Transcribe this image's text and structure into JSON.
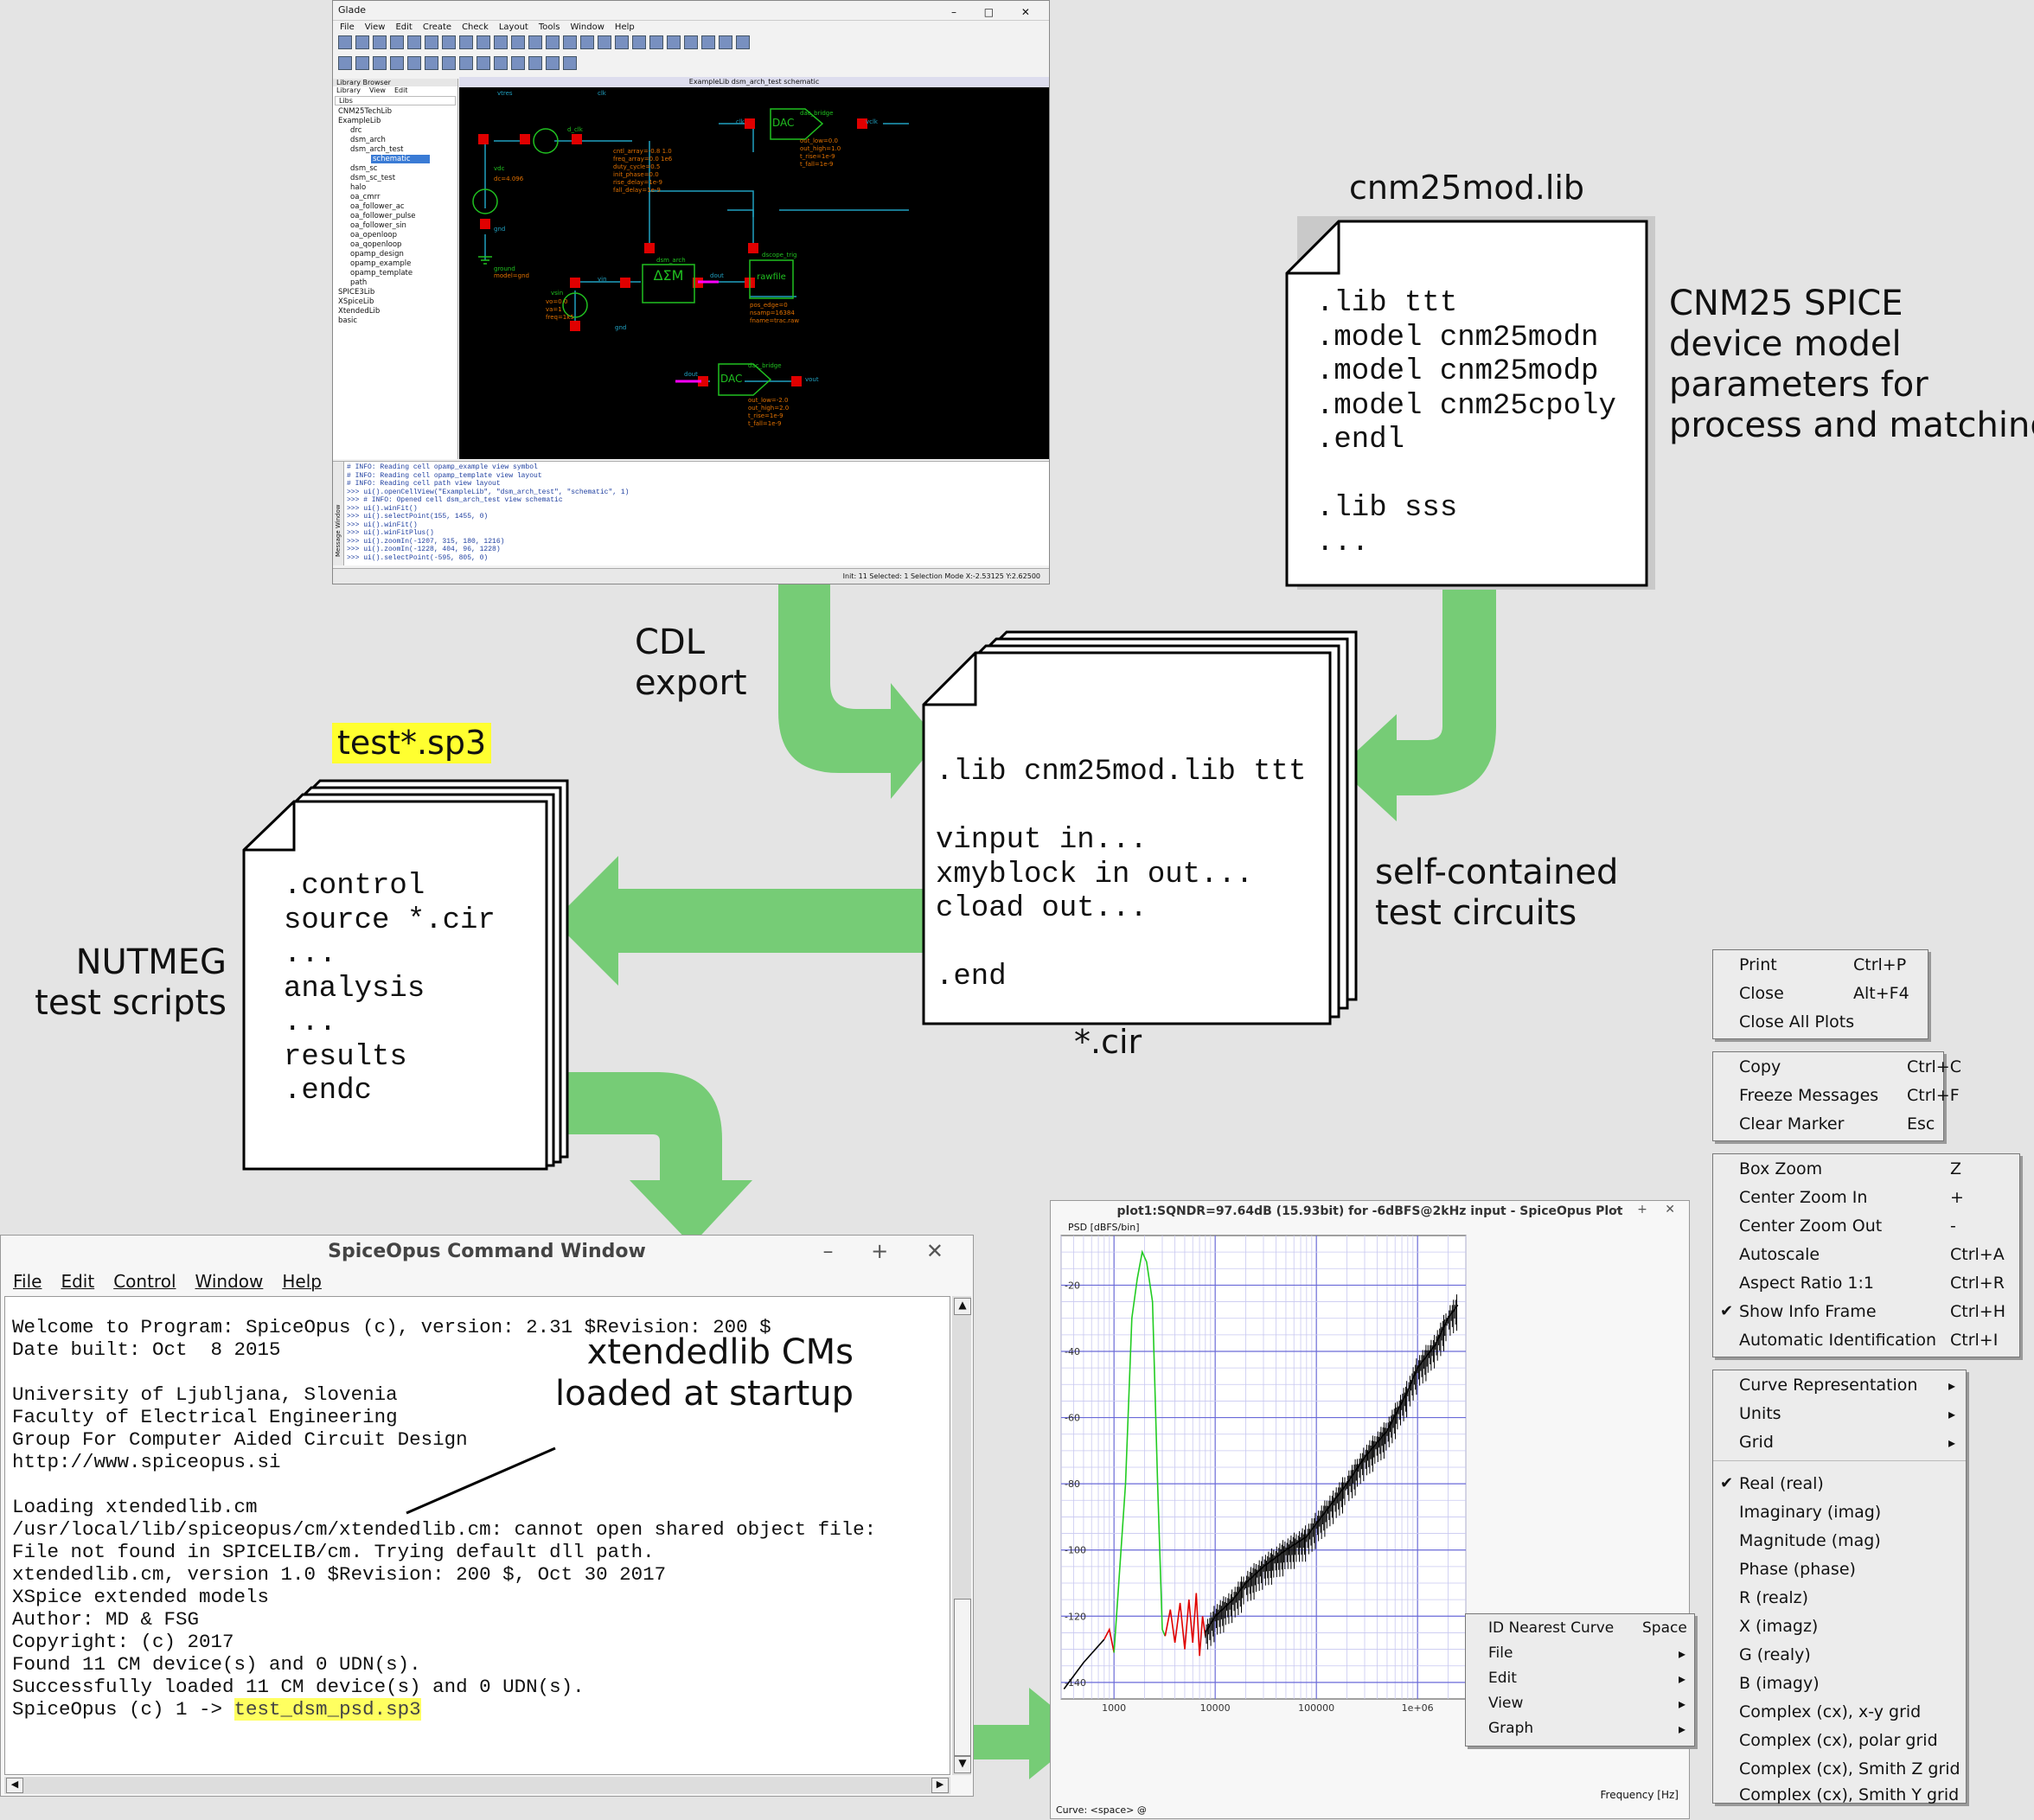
{
  "glade": {
    "title": "Glade",
    "window_controls": "–  □  ✕",
    "menu": [
      "File",
      "View",
      "Edit",
      "Create",
      "Check",
      "Layout",
      "Tools",
      "Window",
      "Help"
    ],
    "library_browser": "Library Browser",
    "lib_menu": [
      "Library",
      "View",
      "Edit"
    ],
    "libs_header": "Libs",
    "libs": [
      "CNM25TechLib",
      "ExampleLib",
      "drc",
      "dsm_arch",
      "dsm_arch_test",
      "schematic",
      "dsm_sc",
      "dsm_sc_test",
      "halo",
      "oa_cmrr",
      "oa_follower_ac",
      "oa_follower_pulse",
      "oa_follower_sin",
      "oa_openloop",
      "oa_qopenloop",
      "opamp_design",
      "opamp_example",
      "opamp_template",
      "path",
      "SPICE3Lib",
      "XSpiceLib",
      "XtendedLib",
      "basic"
    ],
    "schematic_title": "ExampleLib dsm_arch_test schematic",
    "schem_labels": {
      "vtres": "vtres",
      "clk": "clk",
      "dclk": "d_clk",
      "vdc": "vdc",
      "dc": "dc=4.096",
      "gnd": "gnd",
      "ground": "ground",
      "model": "model=gnd",
      "vin": "vin",
      "vsin": "vsin",
      "dsm_arch": "dsm_arch",
      "dout": "dout",
      "dscope": "dscope_trig",
      "dac_bridge": "dac_bridge",
      "vclk": "vclk",
      "vout": "vout",
      "dac": "DAC",
      "sigma": "ΔΣM",
      "rawfile": "rawfile"
    },
    "clk_params": [
      "cntl_array=-0.8 1.0",
      "freq_array=0.0 1e6",
      "duty_cycle=0.5",
      "init_phase=0.0",
      "rise_delay=1e-9",
      "fall_delay=1e-9"
    ],
    "dac_params": [
      "out_low=0.0",
      "out_high=1.0",
      "t_rise=1e-9",
      "t_fall=1e-9"
    ],
    "dac2_params": [
      "out_low=-2.0",
      "out_high=2.0",
      "t_rise=1e-9",
      "t_fall=1e-9"
    ],
    "vsin_params": [
      "vo=0.0",
      "va=1",
      "freq=1k5"
    ],
    "scope_params": [
      "pos_edge=0",
      "nsamp=16384",
      "fname=trac.raw"
    ],
    "messages": [
      "# INFO: Reading cell opamp_example view symbol",
      "# INFO: Reading cell opamp_template view layout",
      "# INFO: Reading cell path view layout",
      ">>> ui().openCellView(\"ExampleLib\", \"dsm_arch_test\", \"schematic\", 1)",
      ">>> # INFO: Opened cell dsm_arch_test view schematic",
      ">>> ui().winFit()",
      ">>> ui().selectPoint(155, 1455, 0)",
      ">>> ui().winFit()",
      ">>> ui().winFitPlus()",
      ">>> ui().zoomIn(-1207, 315, 180, 1216)",
      ">>> ui().zoomIn(-1228, 404, 96, 1228)",
      ">>> ui().selectPoint(-595, 805, 0)"
    ],
    "message_window": "Message Window",
    "status": "Init: 11   Selected: 1   Selection Mode   X:-2.53125 Y:2.62500"
  },
  "cnm_lib": {
    "title": "cnm25mod.lib",
    "text": ".lib ttt\n.model cnm25modn\n.model cnm25modp\n.model cnm25cpoly\n.endl\n\n.lib sss\n..."
  },
  "cnm_desc": [
    "CNM25 SPICE",
    "device model",
    "parameters for",
    "process and matching"
  ],
  "cdl_export": [
    "CDL",
    "export"
  ],
  "cir_doc": {
    "text": ".lib cnm25mod.lib ttt\n\nvinput in...\nxmyblock in out...\ncload out...\n\n.end",
    "label": "*.cir"
  },
  "self_contained": [
    "self-contained",
    "test circuits"
  ],
  "sp3_doc": {
    "label": "test*.sp3",
    "text": ".control\nsource *.cir\n...\nanalysis\n...\nresults\n.endc"
  },
  "nutmeg": [
    "NUTMEG",
    "test scripts"
  ],
  "cmd_window": {
    "title": "SpiceOpus Command Window",
    "controls": "–  +  ✕",
    "menu": [
      "File",
      "Edit",
      "Control",
      "Window",
      "Help"
    ],
    "text": "Welcome to Program: SpiceOpus (c), version: 2.31 $Revision: 200 $\nDate built: Oct  8 2015\n\nUniversity of Ljubljana, Slovenia\nFaculty of Electrical Engineering\nGroup For Computer Aided Circuit Design\nhttp://www.spiceopus.si\n\nLoading xtendedlib.cm\n/usr/local/lib/spiceopus/cm/xtendedlib.cm: cannot open shared object file:\nFile not found in SPICELIB/cm. Trying default dll path.\nxtendedlib.cm, version 1.0 $Revision: 200 $, Oct 30 2017\nXSpice extended models\nAuthor: MD & FSG\nCopyright: (c) 2017\nFound 11 CM device(s) and 0 UDN(s).\nSuccessfully loaded 11 CM device(s) and 0 UDN(s).\n",
    "prompt": "SpiceOpus (c) 1 -> ",
    "command": "test_dsm_psd.sp3",
    "annotation": [
      "xtendedlib CMs",
      "loaded at startup"
    ]
  },
  "plot_window": {
    "title": "plot1:SQNDR=97.64dB (15.93bit) for -6dBFS@2kHz input - SpiceOpus Plot",
    "controls": "–  +  ✕",
    "ylabel": "PSD [dBFS/bin]",
    "xlabel": "Frequency [Hz]",
    "curve": "Curve: <space> @"
  },
  "chart_data": {
    "type": "line",
    "title": "plot1:SQNDR=97.64dB (15.93bit) for -6dBFS@2kHz input - SpiceOpus Plot",
    "xlabel": "Frequency [Hz]",
    "ylabel": "PSD [dBFS/bin]",
    "xscale": "log",
    "xlim": [
      300,
      3000000
    ],
    "ylim": [
      -145,
      -5
    ],
    "x_ticks": [
      "1000",
      "10000",
      "100000",
      "1e+06"
    ],
    "y_ticks": [
      "-20",
      "-40",
      "-60",
      "-80",
      "-100",
      "-120",
      "-140"
    ],
    "grid": true,
    "colors": {
      "black": "#000000",
      "red": "#e00000",
      "green": "#22cc22"
    },
    "series": [
      {
        "color": "#000000",
        "x": [
          320,
          500,
          800
        ],
        "y": [
          -142,
          -134,
          -127
        ]
      },
      {
        "color": "#e00000",
        "x": [
          800,
          900,
          1000
        ],
        "y": [
          -127,
          -124,
          -131
        ]
      },
      {
        "color": "#22cc22",
        "x": [
          1000,
          1300,
          1500,
          1700,
          1900,
          2100,
          2400,
          2700,
          3000,
          3200
        ],
        "y": [
          -131,
          -80,
          -30,
          -18,
          -10,
          -13,
          -25,
          -80,
          -124,
          -126
        ]
      },
      {
        "color": "#e00000",
        "x": [
          3200,
          3600,
          4000,
          4500,
          5000,
          5500,
          6000,
          6500,
          7000,
          7500,
          8000
        ],
        "y": [
          -126,
          -118,
          -128,
          -116,
          -130,
          -115,
          -128,
          -113,
          -132,
          -120,
          -126
        ]
      },
      {
        "color": "#000000",
        "x": [
          8000,
          10000,
          15000,
          20000,
          30000,
          50000,
          80000,
          100000,
          150000,
          200000,
          300000,
          500000,
          800000,
          1000000,
          1500000,
          2000000,
          2500000
        ],
        "y": [
          -125,
          -120,
          -115,
          -110,
          -105,
          -100,
          -96,
          -92,
          -85,
          -80,
          -72,
          -64,
          -52,
          -45,
          -38,
          -30,
          -26
        ]
      }
    ]
  },
  "menus": {
    "file_menu": [
      [
        "Print",
        "Ctrl+P"
      ],
      [
        "Close",
        "Alt+F4"
      ],
      [
        "Close All Plots",
        ""
      ]
    ],
    "edit_menu": [
      [
        "Copy",
        "Ctrl+C"
      ],
      [
        "Freeze Messages",
        "Ctrl+F"
      ],
      [
        "Clear Marker",
        "Esc"
      ]
    ],
    "view_menu": [
      [
        "Box Zoom",
        "Z"
      ],
      [
        "Center Zoom In",
        "+"
      ],
      [
        "Center Zoom Out",
        "-"
      ],
      [
        "Autoscale",
        "Ctrl+A"
      ],
      [
        "Aspect Ratio 1:1",
        "Ctrl+R"
      ],
      [
        "Show Info Frame",
        "Ctrl+H"
      ],
      [
        "Automatic Identification",
        "Ctrl+I"
      ]
    ],
    "graph_menu": [
      "Curve Representation",
      "Units",
      "Grid",
      "Real (real)",
      "Imaginary (imag)",
      "Magnitude (mag)",
      "Phase (phase)",
      "R (realz)",
      "X (imagz)",
      "G (realy)",
      "B (imagy)",
      "Complex (cx), x-y grid",
      "Complex (cx), polar grid",
      "Complex (cx), Smith Z grid",
      "Complex (cx), Smith Y grid"
    ],
    "popup_menu": [
      [
        "ID Nearest Curve",
        "Space"
      ],
      [
        "File",
        ""
      ],
      [
        "Edit",
        ""
      ],
      [
        "View",
        ""
      ],
      [
        "Graph",
        ""
      ]
    ],
    "check": "✔",
    "submenu_arrow": "▸"
  }
}
